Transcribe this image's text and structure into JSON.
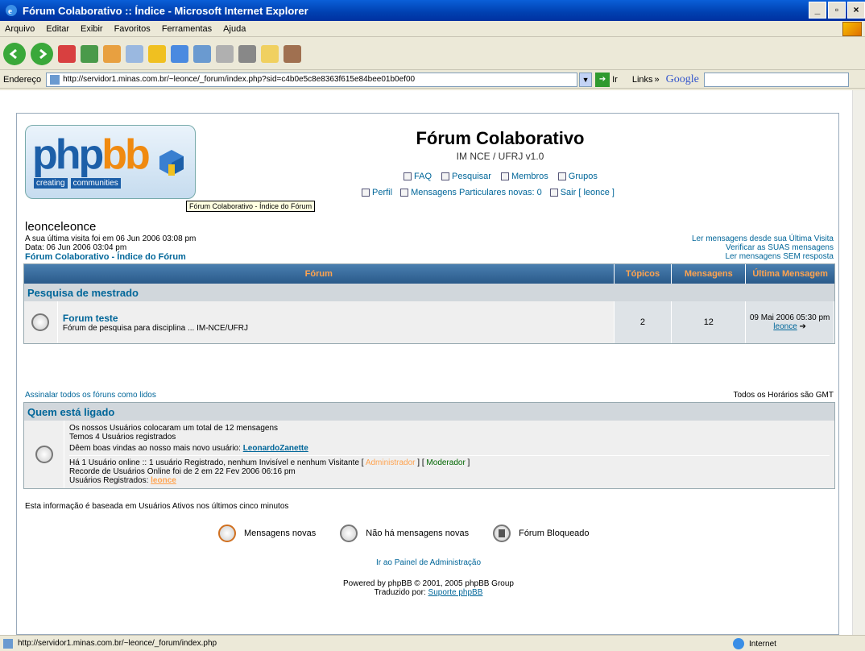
{
  "window": {
    "title": "Fórum Colaborativo :: Índice - Microsoft Internet Explorer",
    "buttons": [
      "_",
      "▫",
      "×"
    ]
  },
  "menu": [
    "Arquivo",
    "Editar",
    "Exibir",
    "Favoritos",
    "Ferramentas",
    "Ajuda"
  ],
  "address": {
    "label": "Endereço",
    "url": "http://servidor1.minas.com.br/~leonce/_forum/index.php?sid=c4b0e5c8e8363f615e84bee01b0ef00",
    "go_label": "Ir",
    "links_label": "Links",
    "google_label": "Google"
  },
  "header": {
    "logo_php": "php",
    "logo_bb": "bb",
    "logo_tag_1": "creating",
    "logo_tag_2": "communities",
    "title": "Fórum Colaborativo",
    "description": "IM NCE / UFRJ v1.0",
    "nav_faq": "FAQ",
    "nav_search": "Pesquisar",
    "nav_members": "Membros",
    "nav_groups": "Grupos",
    "nav_profile": "Perfil",
    "nav_pm": "Mensagens Particulares novas: 0",
    "nav_logout": "Sair [ leonce ]",
    "tooltip": "Fórum Colaborativo - Índice do Fórum"
  },
  "user": {
    "name": "leonceleonce",
    "last_visit": "A sua última visita foi em 06 Jun 2006 03:08 pm",
    "date": "Data: 06 Jun 2006 03:04 pm",
    "index_link": "Fórum Colaborativo - Índice do Fórum",
    "link_since": "Ler mensagens desde sua Última Visita",
    "link_mine": "Verificar as SUAS mensagens",
    "link_unanswered": "Ler mensagens SEM resposta"
  },
  "forum_table": {
    "col_forum": "Fórum",
    "col_topics": "Tópicos",
    "col_msgs": "Mensagens",
    "col_last": "Última Mensagem",
    "category": "Pesquisa de mestrado",
    "forum_name": "Forum teste",
    "forum_desc": "Fórum de pesquisa para disciplina ... IM-NCE/UFRJ",
    "topics": "2",
    "msgs": "12",
    "last_date": "09 Mai 2006 05:30 pm",
    "last_user": "leonce"
  },
  "mark_read": "Assinalar todos os fóruns como lidos",
  "timezone": "Todos os Horários são GMT",
  "who": {
    "title": "Quem está ligado",
    "line1": "Os nossos Usuários colocaram um total de 12 mensagens",
    "line2": "Temos 4 Usuários registrados",
    "line3_prefix": "Dêem boas vindas ao nosso mais novo usuário: ",
    "newest_user": "LeonardoZanette",
    "online_prefix": "Há 1 Usuário online :: 1 usuário Registrado, nenhum Invisível e nenhum Visitante   [ ",
    "admin_label": "Administrador",
    "online_mid": " ]   [ ",
    "mod_label": "Moderador",
    "online_suffix": " ]",
    "record": "Recorde de Usuários Online foi de 2 em 22 Fev 2006 06:16 pm",
    "registered_prefix": "Usuários Registrados: ",
    "registered_user": "leonce"
  },
  "legend_info": "Esta informação é baseada em Usuários Ativos nos últimos cinco minutos",
  "legend": {
    "new": "Mensagens novas",
    "no_new": "Não há mensagens novas",
    "locked": "Fórum Bloqueado"
  },
  "footer": {
    "admin_panel": "Ir ao Painel de Administração",
    "powered": "Powered by phpBB © 2001, 2005 phpBB Group",
    "translated_prefix": "Traduzido por: ",
    "translated_link": "Suporte phpBB"
  },
  "status": {
    "url": "http://servidor1.minas.com.br/~leonce/_forum/index.php",
    "zone": "Internet"
  }
}
